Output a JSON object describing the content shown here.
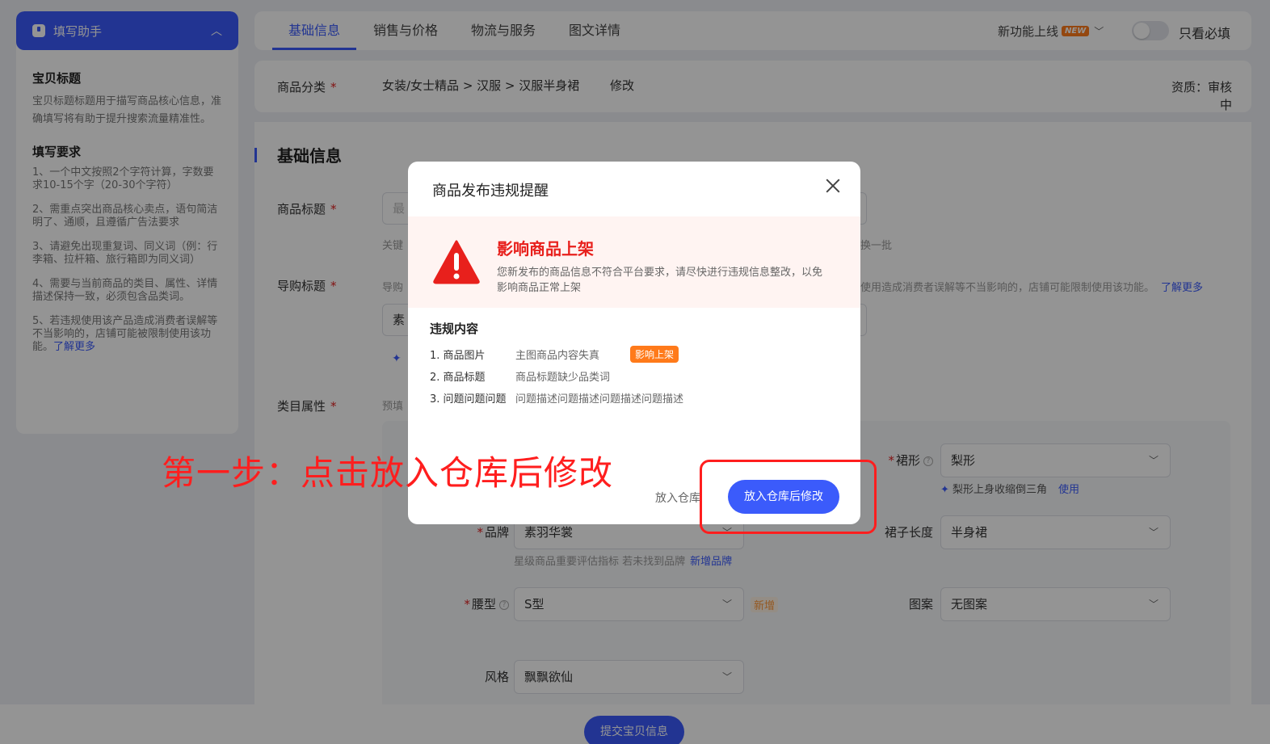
{
  "helper": {
    "title": "填写助手",
    "section1_title": "宝贝标题",
    "section1_desc": "宝贝标题标题用于描写商品核心信息，准确填写将有助于提升搜索流量精准性。",
    "section2_title": "填写要求",
    "rules": [
      "1、一个中文按照2个字符计算，字数要求10-15个字（20-30个字符）",
      "2、需重点突出商品核心卖点，语句简洁明了、通顺，且遵循广告法要求",
      "3、请避免出现重复词、同义词（例：行李箱、拉杆箱、旅行箱即为同义词）",
      "4、需要与当前商品的类目、属性、详情描述保持一致，必须包含品类词。",
      "5、若违规使用该产品造成消费者误解等不当影响的，店铺可能被限制使用该功能。"
    ],
    "learn_more": "了解更多"
  },
  "tabs": [
    {
      "label": "基础信息"
    },
    {
      "label": "销售与价格"
    },
    {
      "label": "物流与服务"
    },
    {
      "label": "图文详情"
    }
  ],
  "toolbar": {
    "new_feature": "新功能上线",
    "new_badge": "NEW",
    "only_required": "只看必填"
  },
  "category": {
    "label": "商品分类",
    "path": "女装/女士精品 > 汉服 > 汉服半身裙",
    "modify": "修改",
    "qualification": "资质：审核中"
  },
  "form": {
    "section_title": "基础信息",
    "title_label": "商品标题",
    "title_placeholder": "最",
    "keyword_hint": "关键",
    "swap_batch": "换一批",
    "guide_label": "导购标题",
    "guide_hint_prefix": "导购",
    "guide_hint_suffix": "使用造成消费者误解等不当影响的，店铺可能限制使用该功能。",
    "guide_learn_more": "了解更多",
    "guide_value": "素",
    "attr_label": "类目属性",
    "attr_hint": "预填"
  },
  "attrs": {
    "skirt_shape_label": "裙形",
    "skirt_shape_value": "梨形",
    "skirt_shape_suggestion": "梨形上身收缩倒三角",
    "use": "使用",
    "brand_label": "品牌",
    "brand_value": "素羽华裳",
    "brand_hint": "星级商品重要评估指标 若未找到品牌",
    "new_brand": "新增品牌",
    "skirt_length_label": "裙子长度",
    "skirt_length_value": "半身裙",
    "waist_label": "腰型",
    "waist_value": "S型",
    "new_tag": "新增",
    "pattern_label": "图案",
    "pattern_value": "无图案",
    "style_label": "风格",
    "style_value": "飘飘欲仙"
  },
  "footer": {
    "submit": "提交宝贝信息"
  },
  "modal": {
    "title": "商品发布违规提醒",
    "warn_title": "影响商品上架",
    "warn_desc": "您新发布的商品信息不符合平台要求，请尽快进行违规信息整改，以免影响商品正常上架",
    "violations_title": "违规内容",
    "violations": [
      {
        "name": "1. 商品图片",
        "reason": "主图商品内容失真",
        "badge": "影响上架"
      },
      {
        "name": "2. 商品标题",
        "reason": "商品标题缺少品类词",
        "badge": ""
      },
      {
        "name": "3. 问题问题问题",
        "reason": "问题描述问题描述问题描述问题描述",
        "badge": ""
      }
    ],
    "btn_warehouse": "放入仓库",
    "btn_warehouse_modify": "放入仓库后修改"
  },
  "annotation": {
    "step": "第一步：点击放入仓库后修改"
  },
  "colors": {
    "brand": "#3b5bfb",
    "danger": "#e8201c",
    "orange": "#ff7a1a"
  }
}
